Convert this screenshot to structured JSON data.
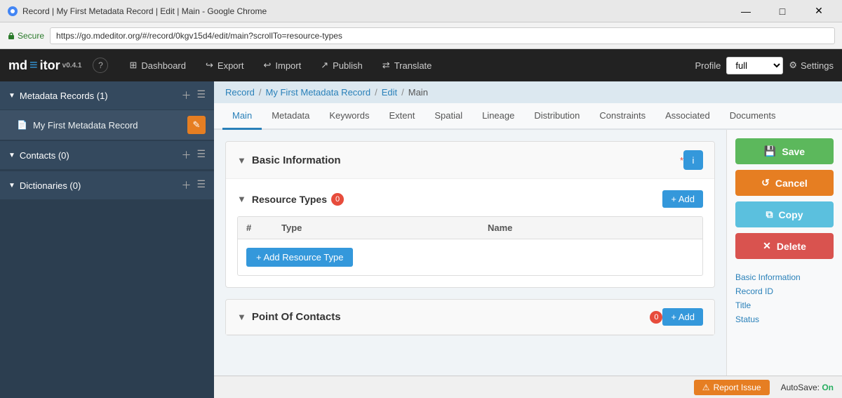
{
  "titlebar": {
    "title": "Record | My First Metadata Record | Edit | Main - Google Chrome",
    "minimize": "—",
    "maximize": "□",
    "close": "✕"
  },
  "browser": {
    "secure_label": "Secure",
    "url": "https://go.mdeditor.org/#/record/0kgv15d4/edit/main?scrollTo=resource-types"
  },
  "topnav": {
    "logo": "md",
    "logo_separator": "≡",
    "logo_app": "itor",
    "version": "v0.4.1",
    "help_label": "?",
    "dashboard_label": "Dashboard",
    "export_label": "Export",
    "import_label": "Import",
    "publish_label": "Publish",
    "translate_label": "Translate",
    "profile_label": "Profile",
    "profile_value": "full",
    "settings_label": "Settings"
  },
  "sidebar": {
    "metadata_section_title": "Metadata Records (1)",
    "records": [
      {
        "name": "My First Metadata Record",
        "icon": "📄"
      }
    ],
    "contacts_section_title": "Contacts (0)",
    "dictionaries_section_title": "Dictionaries (0)"
  },
  "breadcrumb": {
    "record": "Record",
    "sep1": "/",
    "record_name": "My First Metadata Record",
    "sep2": "/",
    "edit": "Edit",
    "sep3": "/",
    "main": "Main"
  },
  "tabs": [
    {
      "label": "Main",
      "active": true
    },
    {
      "label": "Metadata",
      "active": false
    },
    {
      "label": "Keywords",
      "active": false
    },
    {
      "label": "Extent",
      "active": false
    },
    {
      "label": "Spatial",
      "active": false
    },
    {
      "label": "Lineage",
      "active": false
    },
    {
      "label": "Distribution",
      "active": false
    },
    {
      "label": "Constraints",
      "active": false
    },
    {
      "label": "Associated",
      "active": false
    },
    {
      "label": "Documents",
      "active": false
    }
  ],
  "cards": {
    "basic_info": {
      "title": "Basic Information",
      "required": "*"
    },
    "resource_types": {
      "title": "Resource Types",
      "badge": "0",
      "add_label": "+ Add",
      "table_headers": [
        "#",
        "Type",
        "Name"
      ],
      "add_resource_label": "+ Add Resource Type"
    },
    "point_of_contacts": {
      "title": "Point Of Contacts",
      "badge": "0",
      "add_label": "+ Add"
    }
  },
  "actions": {
    "save_label": "Save",
    "cancel_label": "Cancel",
    "copy_label": "Copy",
    "delete_label": "Delete"
  },
  "right_nav": {
    "links": [
      "Basic Information",
      "Record ID",
      "Title",
      "Status"
    ]
  },
  "bottom": {
    "report_label": "Report Issue",
    "autosave_label": "AutoSave:",
    "autosave_value": "On"
  }
}
